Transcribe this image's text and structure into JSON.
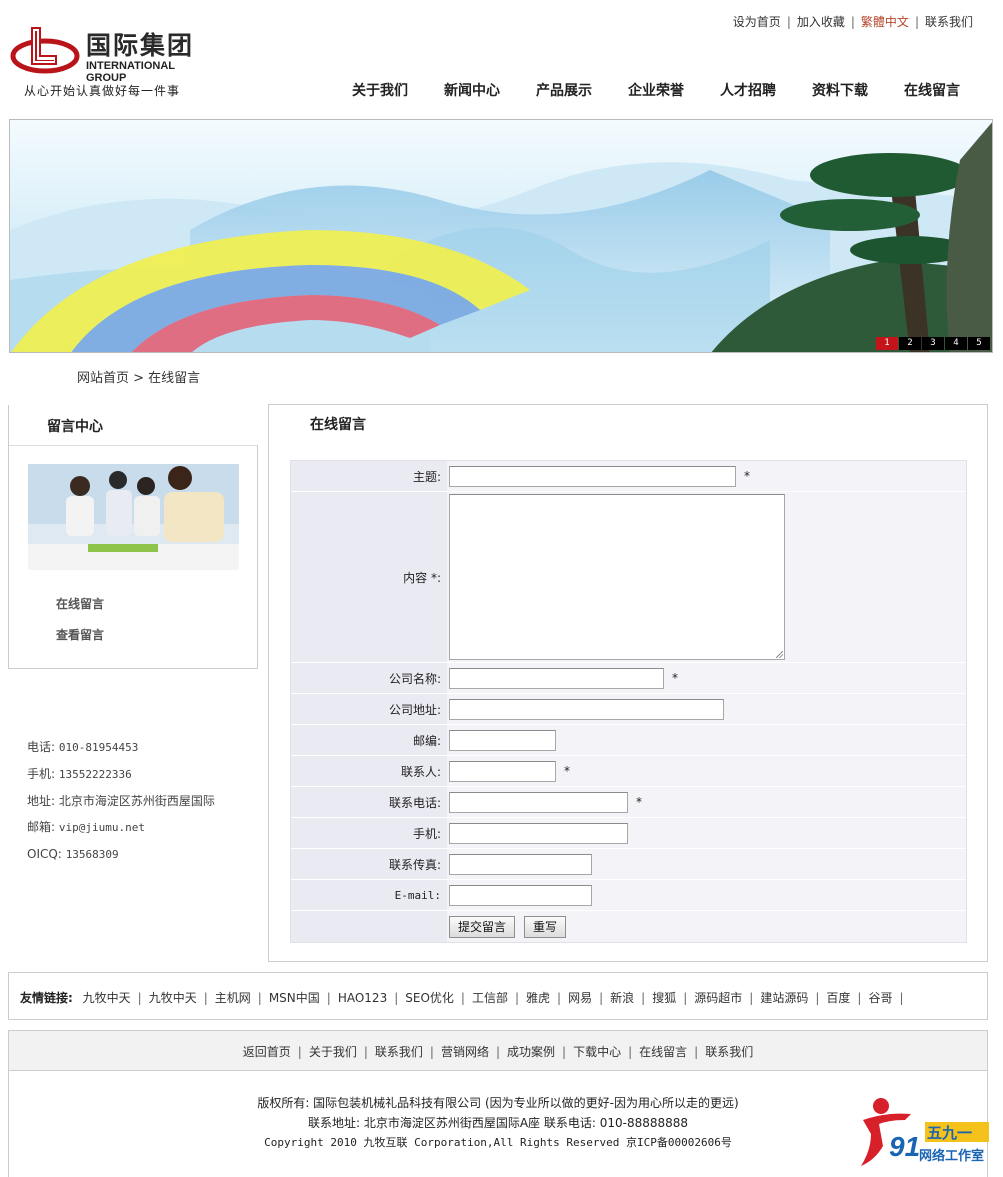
{
  "header": {
    "logo_cn": "国际集团",
    "logo_en": "INTERNATIONAL GROUP",
    "slogan": "从心开始认真做好每一件事",
    "toplinks": [
      "设为首页",
      "加入收藏",
      "繁體中文",
      "联系我们"
    ],
    "nav": [
      "关于我们",
      "新闻中心",
      "产品展示",
      "企业荣誉",
      "人才招聘",
      "资料下载",
      "在线留言"
    ]
  },
  "banner": {
    "slides": [
      "1",
      "2",
      "3",
      "4",
      "5"
    ],
    "active_slide": 1
  },
  "breadcrumb": "网站首页 > 在线留言",
  "left": {
    "title": "留言中心",
    "links": [
      "在线留言",
      "查看留言"
    ],
    "contact": {
      "phone_label": "电话:",
      "phone": "010-81954453",
      "mobile_label": "手机:",
      "mobile": "13552222336",
      "address_label": "地址:",
      "address": "北京市海淀区苏州街西屋国际",
      "email_label": "邮箱:",
      "email": "vip@jiumu.net",
      "oicq_label": "OICQ:",
      "oicq": "13568309"
    }
  },
  "form": {
    "title": "在线留言",
    "star": "*",
    "subject_label": "主题:",
    "content_label": "内容 *:",
    "company_label": "公司名称:",
    "address_label": "公司地址:",
    "zip_label": "邮编:",
    "contact_label": "联系人:",
    "phone_label": "联系电话:",
    "mobile_label": "手机:",
    "fax_label": "联系传真:",
    "email_label": "E-mail:",
    "submit": "提交留言",
    "reset": "重写"
  },
  "friend_links": {
    "label": "友情链接:",
    "items": [
      "九牧中天",
      "九牧中天",
      "主机网",
      "MSN中国",
      "HAO123",
      "SEO优化",
      "工信部",
      "雅虎",
      "网易",
      "新浪",
      "搜狐",
      "源码超市",
      "建站源码",
      "百度",
      "谷哥"
    ]
  },
  "footer": {
    "nav": [
      "返回首页",
      "关于我们",
      "联系我们",
      "营销网络",
      "成功案例",
      "下载中心",
      "在线留言",
      "联系我们"
    ],
    "copyright": "版权所有: 国际包装机械礼品科技有限公司 (因为专业所以做的更好-因为用心所以走的更远)",
    "contact_line": "联系地址: 北京市海淀区苏州街西屋国际A座 联系电话: 010-88888888",
    "copyright_en": "Copyright 2010 九牧互联 Corporation,All Rights Reserved 京ICP备00002606号"
  },
  "badge": {
    "number": "91",
    "cn_top": "五九一",
    "cn_bottom": "网络工作室"
  },
  "colors": {
    "accent_red": "#c4141a",
    "toplink_highlight": "#b5462c",
    "form_bg": "#eaeaf2"
  }
}
